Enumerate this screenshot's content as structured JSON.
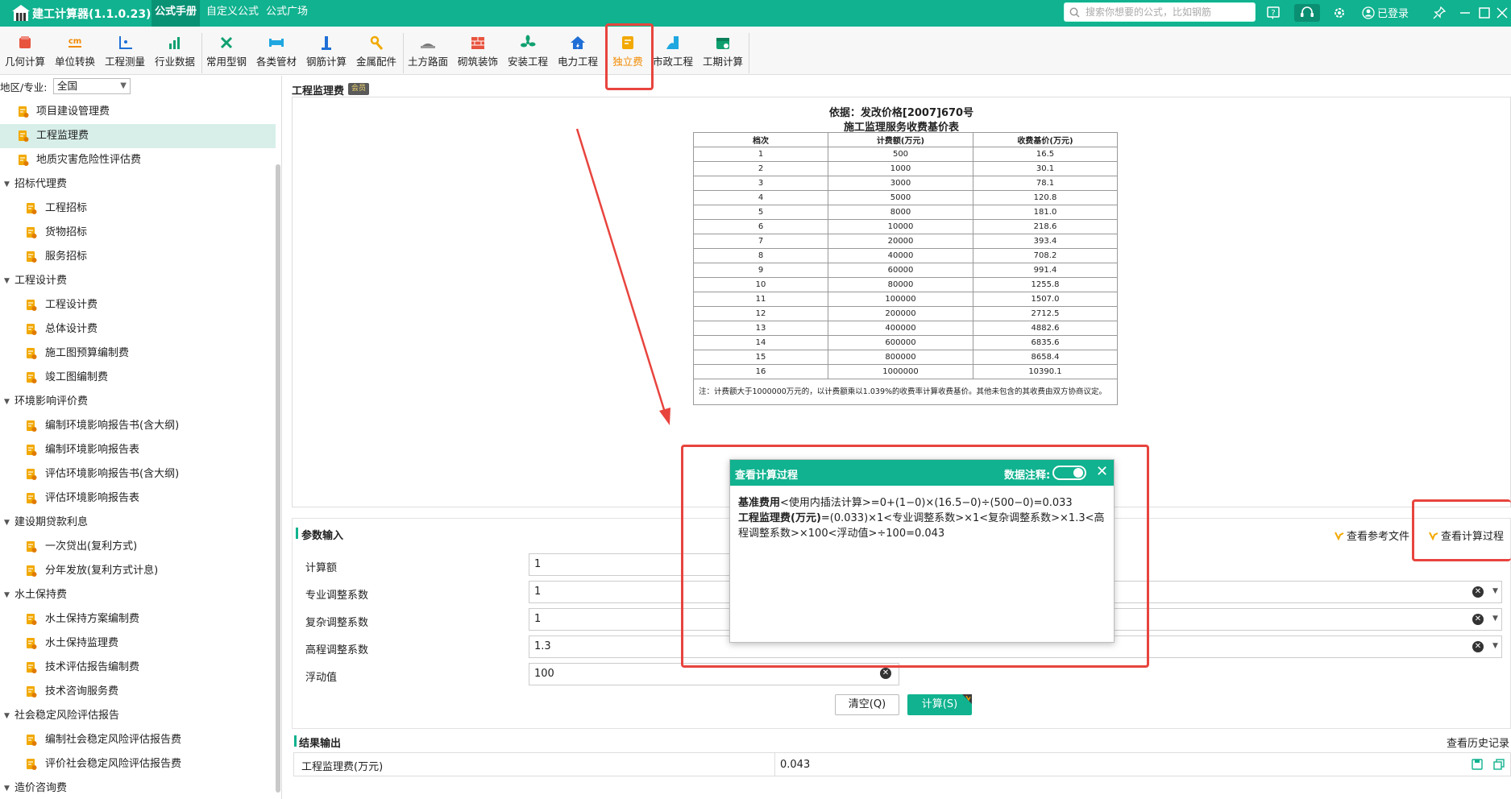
{
  "app": {
    "title": "建工计算器(1.1.0.23)"
  },
  "top_tabs": [
    {
      "label": "公式手册",
      "active": true
    },
    {
      "label": "自定义公式"
    },
    {
      "label": "公式广场"
    }
  ],
  "search": {
    "placeholder": "搜索你想要的公式，比如钢筋"
  },
  "login_label": "已登录",
  "ribbon": [
    {
      "label": "几何计算",
      "icon": "geometry-icon",
      "color": "#e8533e"
    },
    {
      "label": "单位转换",
      "icon": "unit-cm-icon",
      "color": "#f28a00"
    },
    {
      "label": "工程测量",
      "icon": "axis-icon",
      "color": "#1f6fd6"
    },
    {
      "label": "行业数据",
      "icon": "bar-chart-icon",
      "color": "#10a070"
    },
    {
      "label": "常用型钢",
      "icon": "wrench-icon",
      "color": "#10a070"
    },
    {
      "label": "各类管材",
      "icon": "pipe-icon",
      "color": "#1fa7e0"
    },
    {
      "label": "钢筋计算",
      "icon": "rebar-icon",
      "color": "#1f6fd6"
    },
    {
      "label": "金属配件",
      "icon": "fitting-icon",
      "color": "#f2a900"
    },
    {
      "label": "土方路面",
      "icon": "road-icon",
      "color": "#777777"
    },
    {
      "label": "砌筑装饰",
      "icon": "brick-icon",
      "color": "#e8533e"
    },
    {
      "label": "安装工程",
      "icon": "fan-icon",
      "color": "#10a070"
    },
    {
      "label": "电力工程",
      "icon": "house-power-icon",
      "color": "#1f6fd6"
    },
    {
      "label": "独立费",
      "icon": "coin-doc-icon",
      "color": "#f2a900",
      "active": true
    },
    {
      "label": "市政工程",
      "icon": "municipal-icon",
      "color": "#1fa7e0"
    },
    {
      "label": "工期计算",
      "icon": "calendar-icon",
      "color": "#10a070"
    }
  ],
  "region": {
    "label": "地区/专业:",
    "value": "全国"
  },
  "tree": [
    {
      "label": "项目建设管理费",
      "level": 1
    },
    {
      "label": "工程监理费",
      "level": 1,
      "selected": true
    },
    {
      "label": "地质灾害危险性评估费",
      "level": 1
    },
    {
      "label": "招标代理费",
      "level": 0
    },
    {
      "label": "工程招标",
      "level": 2
    },
    {
      "label": "货物招标",
      "level": 2
    },
    {
      "label": "服务招标",
      "level": 2
    },
    {
      "label": "工程设计费",
      "level": 0
    },
    {
      "label": "工程设计费",
      "level": 2
    },
    {
      "label": "总体设计费",
      "level": 2
    },
    {
      "label": "施工图预算编制费",
      "level": 2
    },
    {
      "label": "竣工图编制费",
      "level": 2
    },
    {
      "label": "环境影响评价费",
      "level": 0
    },
    {
      "label": "编制环境影响报告书(含大纲)",
      "level": 2
    },
    {
      "label": "编制环境影响报告表",
      "level": 2
    },
    {
      "label": "评估环境影响报告书(含大纲)",
      "level": 2
    },
    {
      "label": "评估环境影响报告表",
      "level": 2
    },
    {
      "label": "建设期贷款利息",
      "level": 0
    },
    {
      "label": "一次贷出(复利方式)",
      "level": 2
    },
    {
      "label": "分年发放(复利方式计息)",
      "level": 2
    },
    {
      "label": "水土保持费",
      "level": 0
    },
    {
      "label": "水土保持方案编制费",
      "level": 2
    },
    {
      "label": "水土保持监理费",
      "level": 2
    },
    {
      "label": "技术评估报告编制费",
      "level": 2
    },
    {
      "label": "技术咨询服务费",
      "level": 2
    },
    {
      "label": "社会稳定风险评估报告",
      "level": 0
    },
    {
      "label": "编制社会稳定风险评估报告费",
      "level": 2
    },
    {
      "label": "评价社会稳定风险评估报告费",
      "level": 2
    },
    {
      "label": "造价咨询费",
      "level": 0
    }
  ],
  "main": {
    "title": "工程监理费",
    "badge": "会员"
  },
  "doc": {
    "basis": "依据：发改价格[2007]670号",
    "table_title": "施工监理服务收费基价表",
    "headers": [
      "档次",
      "计费额(万元)",
      "收费基价(万元)"
    ],
    "rows": [
      [
        "1",
        "500",
        "16.5"
      ],
      [
        "2",
        "1000",
        "30.1"
      ],
      [
        "3",
        "3000",
        "78.1"
      ],
      [
        "4",
        "5000",
        "120.8"
      ],
      [
        "5",
        "8000",
        "181.0"
      ],
      [
        "6",
        "10000",
        "218.6"
      ],
      [
        "7",
        "20000",
        "393.4"
      ],
      [
        "8",
        "40000",
        "708.2"
      ],
      [
        "9",
        "60000",
        "991.4"
      ],
      [
        "10",
        "80000",
        "1255.8"
      ],
      [
        "11",
        "100000",
        "1507.0"
      ],
      [
        "12",
        "200000",
        "2712.5"
      ],
      [
        "13",
        "400000",
        "4882.6"
      ],
      [
        "14",
        "600000",
        "6835.6"
      ],
      [
        "15",
        "800000",
        "8658.4"
      ],
      [
        "16",
        "1000000",
        "10390.1"
      ]
    ],
    "note": "注：计费额大于1000000万元的，以计费额乘以1.039%的收费率计算收费基价。其他未包含的其收费由双方协商议定。"
  },
  "params": {
    "title": "参数输入",
    "ref_link": "查看参考文件",
    "proc_link": "查看计算过程",
    "fields": [
      {
        "label": "计算额",
        "value": "1"
      },
      {
        "label": "专业调整系数",
        "value": "1"
      },
      {
        "label": "复杂调整系数",
        "value": "1"
      },
      {
        "label": "高程调整系数",
        "value": "1.3"
      },
      {
        "label": "浮动值",
        "value": "100"
      }
    ],
    "clear_label": "清空(Q)",
    "calc_label": "计算(S)"
  },
  "results": {
    "title": "结果输出",
    "history_link": "查看历史记录",
    "label": "工程监理费(万元)",
    "value": "0.043"
  },
  "popup": {
    "title": "查看计算过程",
    "annot_label": "数据注释:",
    "line1_bold": "基准费用",
    "line1_rest": "<使用内插法计算>=0+(1−0)×(16.5−0)÷(500−0)=0.033",
    "line2_bold": "工程监理费(万元)",
    "line2_rest": "=(0.033)×1<专业调整系数>×1<复杂调整系数>×1.3<高程调整系数>×100<浮动值>÷100=0.043"
  },
  "colors": {
    "brand": "#10b28f",
    "annotation_red": "#e8443e",
    "active_tab": "#f28a00"
  }
}
